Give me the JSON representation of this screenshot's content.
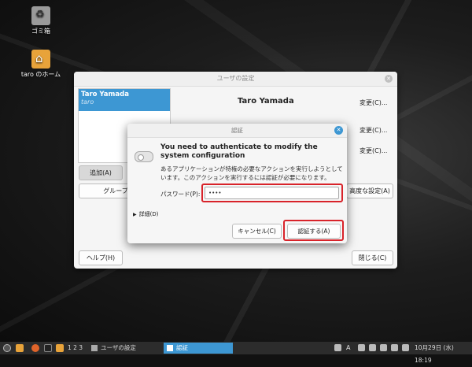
{
  "desktop": {
    "icons": [
      {
        "label": "ゴミ箱",
        "icon": "trash-icon"
      },
      {
        "label": "taro のホーム",
        "icon": "home-folder-icon"
      }
    ]
  },
  "users_window": {
    "title": "ユーザの設定",
    "selected_user": {
      "display_name": "Taro Yamada",
      "login": "taro"
    },
    "detail_name": "Taro Yamada",
    "change_label": "変更(C)...",
    "add_label": "追加(A)",
    "groups_label": "グループの",
    "advanced_label": "高度な設定(A)",
    "help_label": "ヘルプ(H)",
    "close_label": "閉じる(C)"
  },
  "auth_dialog": {
    "title": "認証",
    "heading": "You need to authenticate to modify the system configuration",
    "body": "あるアプリケーションが特権の必要なアクションを実行しようとしています。このアクションを実行するには認証が必要になります。",
    "password_label": "パスワード(P):",
    "password_value": "••••",
    "details_label": "詳細(D)",
    "cancel_label": "キャンセル(C)",
    "authenticate_label": "認証する(A)",
    "highlight_color": "#d8232a"
  },
  "taskbar": {
    "workspaces": "1 2 3",
    "tasks": [
      {
        "label": "ユーザの設定",
        "active": false
      },
      {
        "label": "認証",
        "active": true
      }
    ],
    "clock": "10月29日 (水) 18:19",
    "accent": "#3d97d3"
  }
}
